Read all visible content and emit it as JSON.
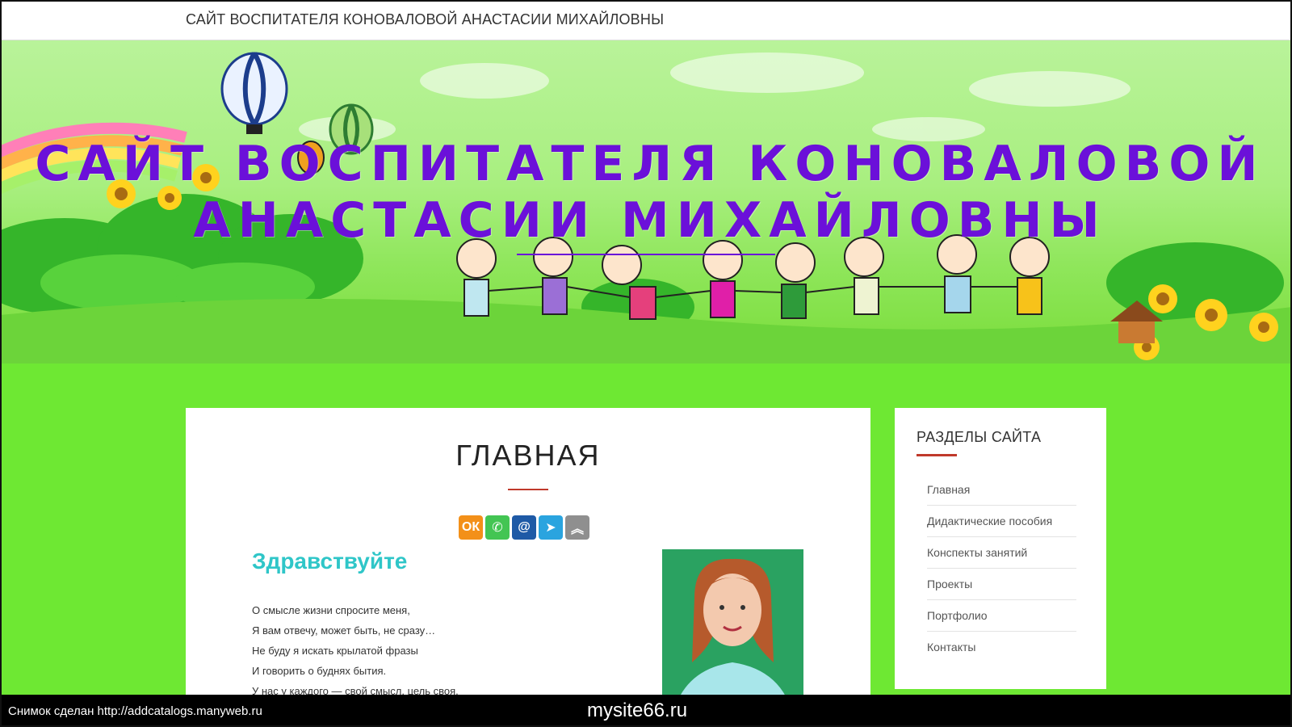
{
  "topbar": {
    "site_title": "САЙТ ВОСПИТАТЕЛЯ КОНОВАЛОВОЙ АНАСТАСИИ МИХАЙЛОВНЫ"
  },
  "hero": {
    "title_line1": "САЙТ ВОСПИТАТЕЛЯ КОНОВАЛОВОЙ",
    "title_line2": "АНАСТАСИИ МИХАЙЛОВНЫ",
    "title_color": "#6b10d9"
  },
  "main": {
    "page_title": "ГЛАВНАЯ",
    "share_buttons": [
      {
        "icon": "odnoklassniki-icon",
        "glyph": "ОК",
        "color": "#f39019"
      },
      {
        "icon": "whatsapp-icon",
        "glyph": "✆",
        "color": "#43c553"
      },
      {
        "icon": "mail-icon",
        "glyph": "@",
        "color": "#1e5aa6"
      },
      {
        "icon": "telegram-icon",
        "glyph": "➤",
        "color": "#2aa4df"
      },
      {
        "icon": "more-icon",
        "glyph": "︽",
        "color": "#8f8f8f"
      }
    ],
    "greeting": "Здравствуйте",
    "poem_lines": [
      "О смысле жизни спросите меня,",
      "Я вам отвечу, может быть, не сразу…",
      "Не буду я искать крылатой фразы",
      "И говорить о буднях бытия.",
      "У нас у каждого — свой смысл, цель своя."
    ]
  },
  "sidebar": {
    "heading": "РАЗДЕЛЫ САЙТА",
    "items": [
      {
        "label": "Главная"
      },
      {
        "label": "Дидактические пособия"
      },
      {
        "label": "Конспекты занятий"
      },
      {
        "label": "Проекты"
      },
      {
        "label": "Портфолио"
      },
      {
        "label": "Контакты"
      }
    ]
  },
  "screenshot_bar": {
    "left_text": "Снимок сделан http://addcatalogs.manyweb.ru",
    "center_text": "mysite66.ru"
  },
  "colors": {
    "page_background": "#6ee833",
    "accent_red": "#c0392b",
    "greeting_teal": "#2fc6c8"
  }
}
